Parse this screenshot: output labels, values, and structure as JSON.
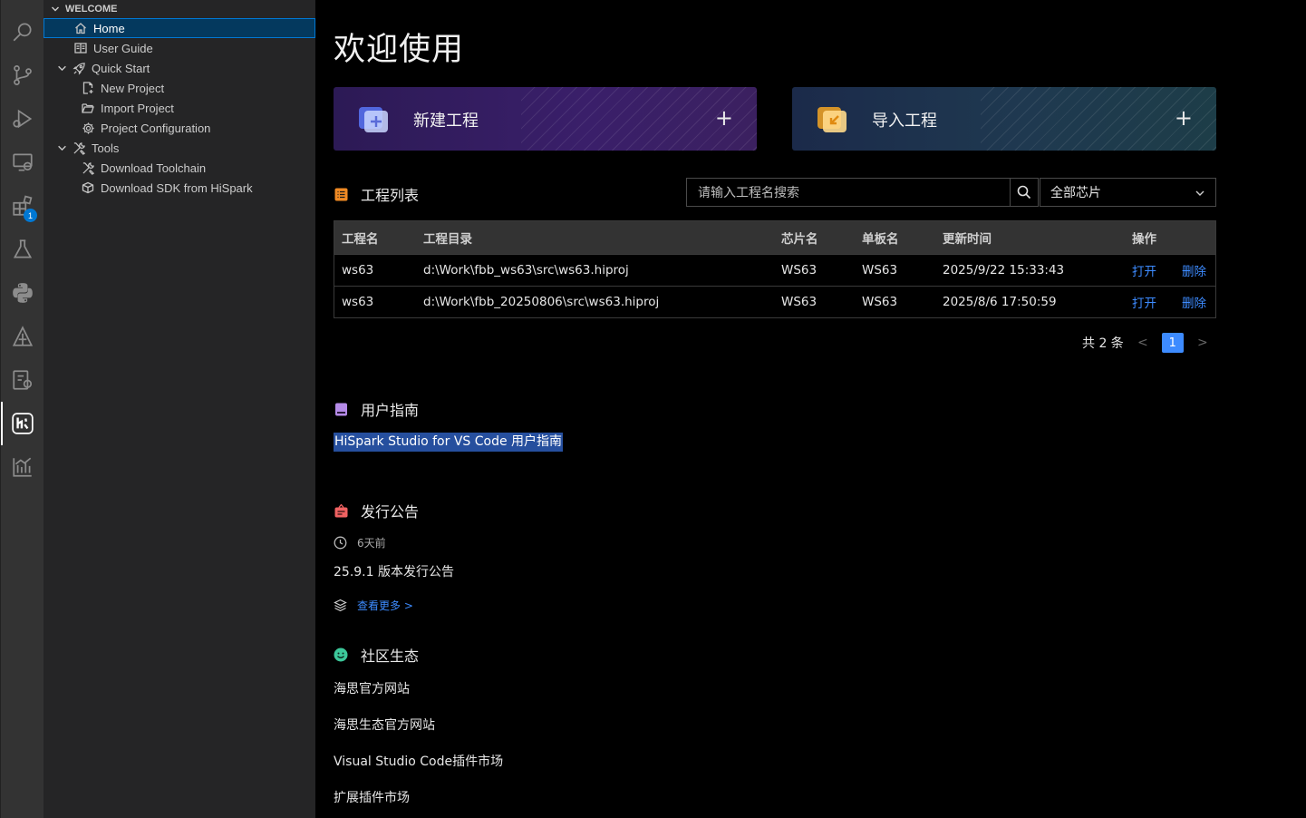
{
  "colors": {
    "activity_bg": "#333333",
    "sidebar_bg": "#252526",
    "selection": "#04395e",
    "accent_blue": "#3d8bff",
    "main_bg": "#000000"
  },
  "activity_bar": {
    "items": [
      {
        "icon": "search-icon"
      },
      {
        "icon": "source-control-icon"
      },
      {
        "icon": "run-debug-icon"
      },
      {
        "icon": "remote-explorer-icon"
      },
      {
        "icon": "extensions-icon",
        "badge": "1"
      },
      {
        "icon": "testing-flask-icon"
      },
      {
        "icon": "python-icon"
      },
      {
        "icon": "deploy-icon"
      },
      {
        "icon": "device-settings-icon"
      },
      {
        "icon": "hispark-icon",
        "active": true
      },
      {
        "icon": "analysis-chart-icon"
      }
    ]
  },
  "sidebar": {
    "section": "WELCOME",
    "items": [
      {
        "label": "Home"
      },
      {
        "label": "User Guide"
      },
      {
        "label": "Quick Start"
      },
      {
        "label": "New Project"
      },
      {
        "label": "Import Project"
      },
      {
        "label": "Project Configuration"
      },
      {
        "label": "Tools"
      },
      {
        "label": "Download Toolchain"
      },
      {
        "label": "Download SDK from HiSpark"
      }
    ]
  },
  "main": {
    "title": "欢迎使用",
    "cards": {
      "new_project": "新建工程",
      "import_project": "导入工程",
      "plus": "+"
    },
    "projects": {
      "title": "工程列表",
      "search_placeholder": "请输入工程名搜索",
      "chip_filter": "全部芯片",
      "columns": [
        "工程名",
        "工程目录",
        "芯片名",
        "单板名",
        "更新时间",
        "操作"
      ],
      "rows": [
        {
          "name": "ws63",
          "dir": "d:\\Work\\fbb_ws63\\src\\ws63.hiproj",
          "chip": "WS63",
          "board": "WS63",
          "time": "2025/9/22 15:33:43",
          "open": "打开",
          "delete": "删除"
        },
        {
          "name": "ws63",
          "dir": "d:\\Work\\fbb_20250806\\src\\ws63.hiproj",
          "chip": "WS63",
          "board": "WS63",
          "time": "2025/8/6 17:50:59",
          "open": "打开",
          "delete": "删除"
        }
      ],
      "total": "共 2 条",
      "page": "1",
      "prev": "<",
      "next": ">"
    },
    "guide": {
      "title": "用户指南",
      "link": "HiSpark Studio for VS Code 用户指南"
    },
    "release": {
      "title": "发行公告",
      "time": "6天前",
      "notice": "25.9.1 版本发行公告",
      "more": "查看更多 >"
    },
    "community": {
      "title": "社区生态",
      "links": [
        "海思官方网站",
        "海思生态官方网站",
        "Visual Studio Code插件市场",
        "扩展插件市场"
      ]
    }
  }
}
